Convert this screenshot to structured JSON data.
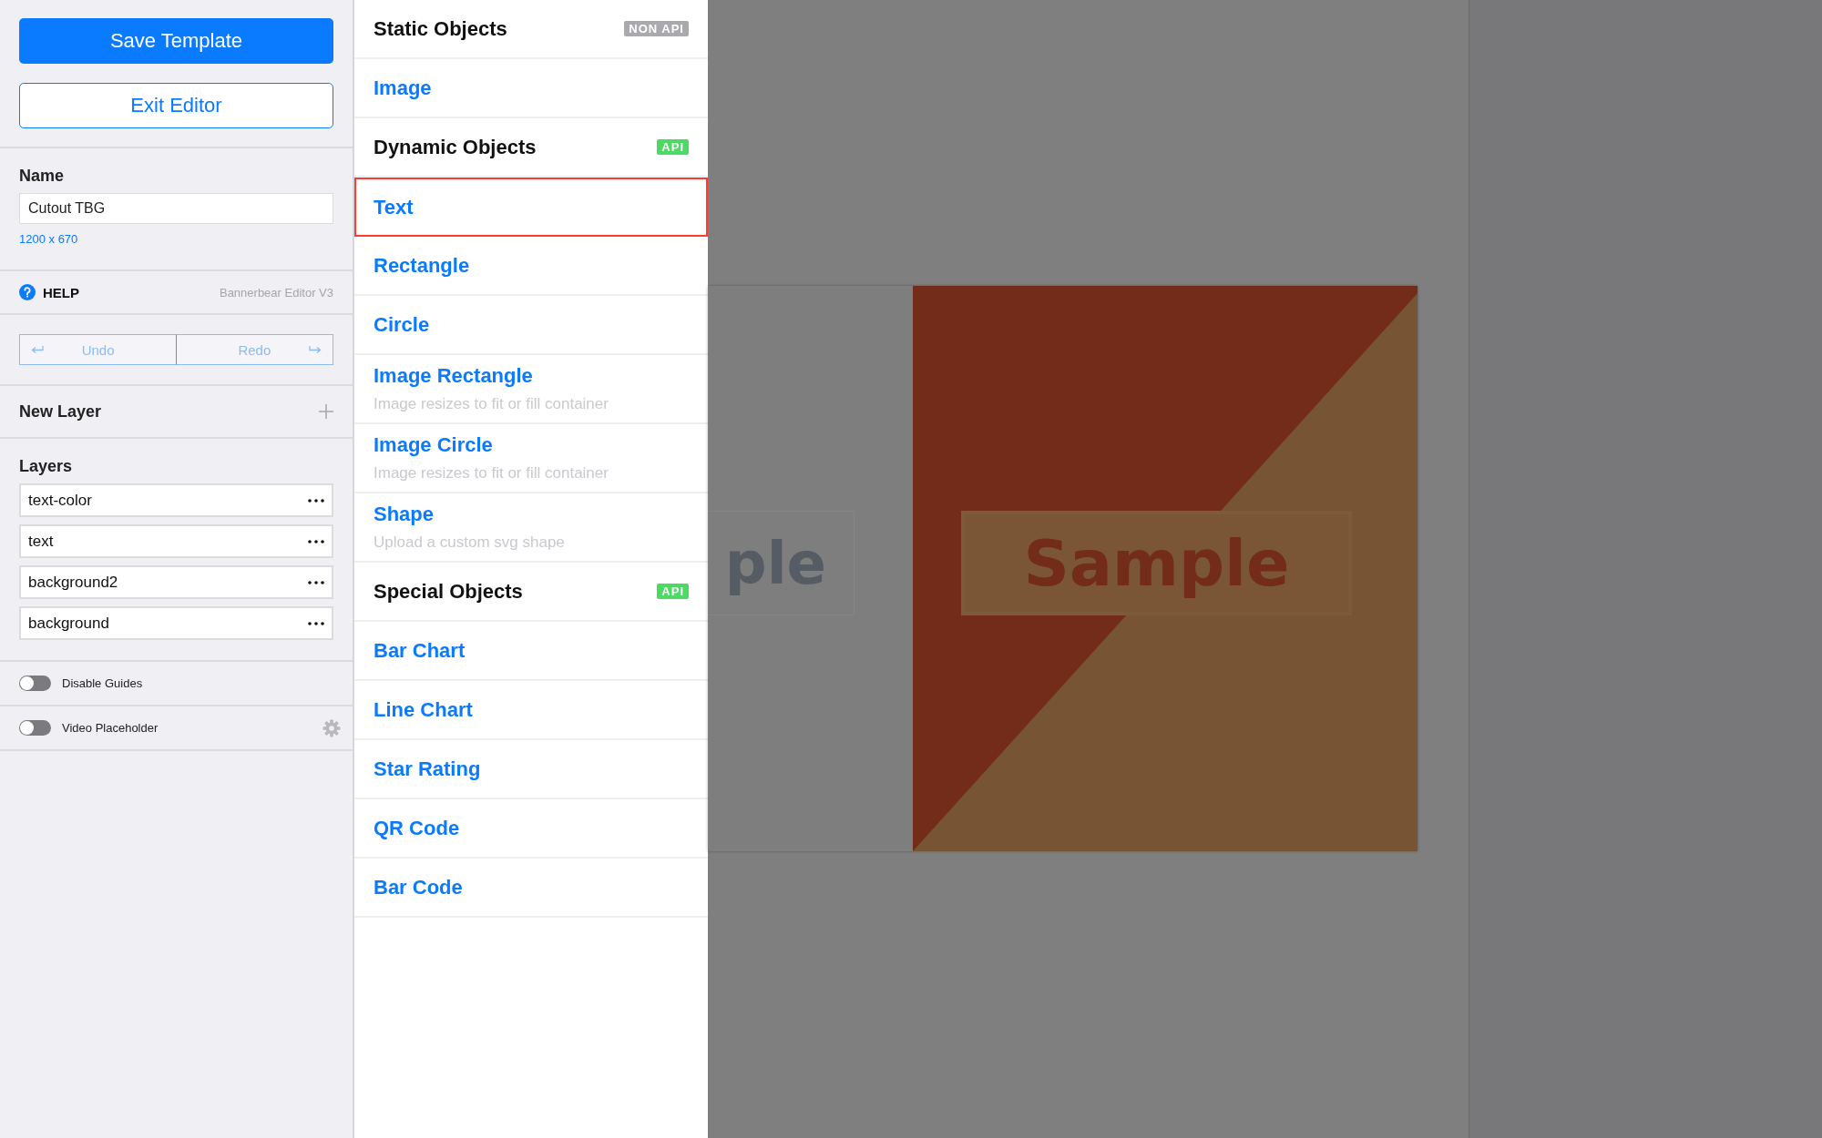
{
  "sidebar": {
    "save_button": "Save Template",
    "exit_button": "Exit Editor",
    "name_label": "Name",
    "name_field": {
      "value": "Cutout TBG"
    },
    "dimensions": "1200 x 670",
    "help": {
      "label": "HELP",
      "version": "Bannerbear Editor V3"
    },
    "undo": "Undo",
    "redo": "Redo",
    "new_layer": "New Layer",
    "layers_label": "Layers",
    "layers": [
      "text-color",
      "text",
      "background2",
      "background"
    ],
    "toggles": [
      {
        "kind": "plain",
        "label": "Disable Guides",
        "on": false
      },
      {
        "kind": "with_settings",
        "label": "Video Placeholder",
        "on": false
      }
    ]
  },
  "object_menu": {
    "items": [
      {
        "kind": "header",
        "label": "Static Objects",
        "badge": {
          "text": "NON API",
          "color": "#a9a9b0"
        }
      },
      {
        "kind": "option",
        "label": "Image",
        "selected": false
      },
      {
        "kind": "header",
        "label": "Dynamic Objects",
        "badge": {
          "text": "API",
          "color": "#4cd964"
        }
      },
      {
        "kind": "option",
        "label": "Text",
        "selected": true
      },
      {
        "kind": "option",
        "label": "Rectangle",
        "selected": false
      },
      {
        "kind": "option",
        "label": "Circle",
        "selected": false
      },
      {
        "kind": "option",
        "label": "Image Rectangle",
        "description": "Image resizes to fit or fill container",
        "selected": false
      },
      {
        "kind": "option",
        "label": "Image Circle",
        "description": "Image resizes to fit or fill container",
        "selected": false
      },
      {
        "kind": "option",
        "label": "Shape",
        "description": "Upload a custom svg shape",
        "selected": false
      },
      {
        "kind": "header",
        "label": "Special Objects",
        "badge": {
          "text": "API",
          "color": "#4cd964"
        }
      },
      {
        "kind": "option",
        "label": "Bar Chart",
        "selected": false
      },
      {
        "kind": "option",
        "label": "Line Chart",
        "selected": false
      },
      {
        "kind": "option",
        "label": "Star Rating",
        "selected": false
      },
      {
        "kind": "option",
        "label": "QR Code",
        "selected": false
      },
      {
        "kind": "option",
        "label": "Bar Code",
        "selected": false
      }
    ]
  },
  "canvas": {
    "layers": [
      {
        "kind": "cut_text",
        "text": "ple"
      },
      {
        "kind": "text",
        "text": "Sample"
      }
    ]
  }
}
